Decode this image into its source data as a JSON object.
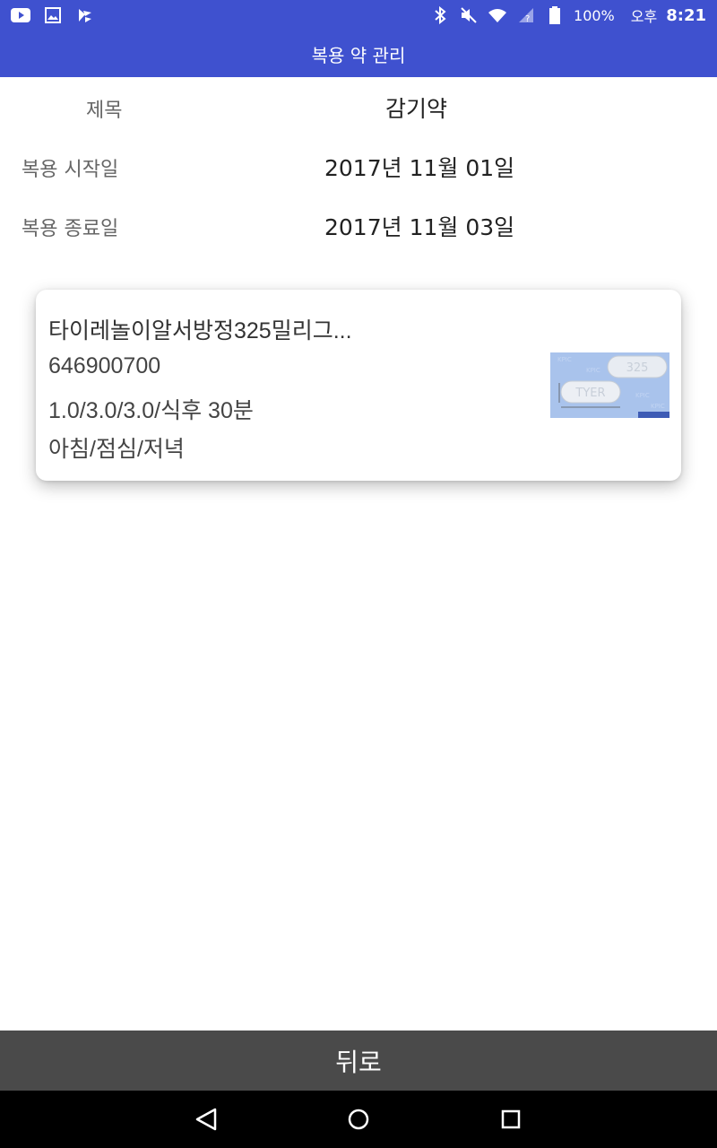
{
  "status_bar": {
    "battery": "100%",
    "ampm": "오후",
    "time": "8:21",
    "icons": [
      "youtube-icon",
      "gallery-icon",
      "app-icon",
      "bluetooth-icon",
      "mute-icon",
      "wifi-icon",
      "signal-icon",
      "battery-icon"
    ]
  },
  "app_bar": {
    "title": "복용 약 관리"
  },
  "info": {
    "title_label": "제목",
    "title_value": "감기약",
    "start_label": "복용 시작일",
    "start_value": "2017년 11월 01일",
    "end_label": "복용 종료일",
    "end_value": "2017년 11월 03일"
  },
  "medicine_card": {
    "name": "타이레놀이알서방정325밀리그...",
    "code": "646900700",
    "dosage": "1.0/3.0/3.0/식후 30분",
    "schedule": "아침/점심/저녁",
    "pill_marks": [
      "325",
      "TYER"
    ]
  },
  "back_button": {
    "label": "뒤로"
  },
  "colors": {
    "primary": "#3f51cf",
    "back_bar": "#4a4a4a"
  }
}
